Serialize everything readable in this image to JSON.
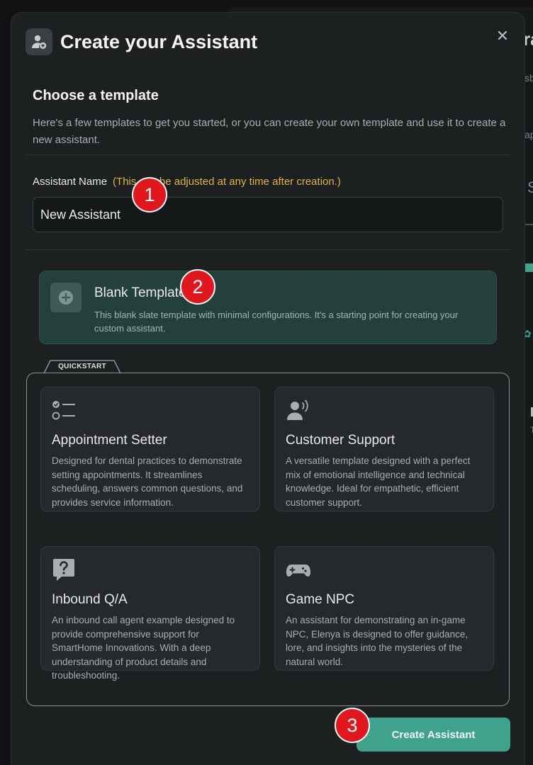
{
  "background": {
    "fragment_a": "ra",
    "fragment_b": "sb",
    "fragment_c": "ap",
    "fragment_d": "S",
    "fragment_e": "I",
    "fragment_f": "T"
  },
  "modal": {
    "title": "Create your Assistant",
    "header_icon": "user-plus-icon",
    "close_icon": "close-icon",
    "close_glyph": "✕"
  },
  "template_section": {
    "title": "Choose a template",
    "description": "Here's a few templates to get you started, or you can create your own template and use it to create a new assistant."
  },
  "assistant_name": {
    "label": "Assistant Name",
    "hint": "(This can be adjusted at any time after creation.)",
    "value": "New Assistant"
  },
  "blank_template": {
    "title": "Blank Template",
    "description": "This blank slate template with minimal configurations. It's a starting point for creating your custom assistant.",
    "icon": "plus-circle-icon"
  },
  "quickstart": {
    "label": "QUICKSTART",
    "templates": [
      {
        "title": "Appointment Setter",
        "description": "Designed for dental practices to demonstrate setting appointments. It streamlines scheduling, answers common questions, and provides service information.",
        "icon": "checklist-icon"
      },
      {
        "title": "Customer Support",
        "description": "A versatile template designed with a perfect mix of emotional intelligence and technical knowledge. Ideal for empathetic, efficient customer support.",
        "icon": "speaking-person-icon"
      },
      {
        "title": "Inbound Q/A",
        "description": "An inbound call agent example designed to provide comprehensive support for SmartHome Innovations. With a deep understanding of product details and troubleshooting.",
        "icon": "question-bubble-icon"
      },
      {
        "title": "Game NPC",
        "description": "An assistant for demonstrating an in-game NPC, Elenya is designed to offer guidance, lore, and insights into the mysteries of the natural world.",
        "icon": "gamepad-icon"
      }
    ]
  },
  "create_button": {
    "label": "Create Assistant"
  },
  "annotations": {
    "step1": "1",
    "step2": "2",
    "step3": "3"
  },
  "colors": {
    "accent": "#3fa38b",
    "hint": "#e0b440",
    "badge": "#e2171d",
    "blank_card_bg": "#23403a",
    "modal_bg": "#1d2021"
  }
}
